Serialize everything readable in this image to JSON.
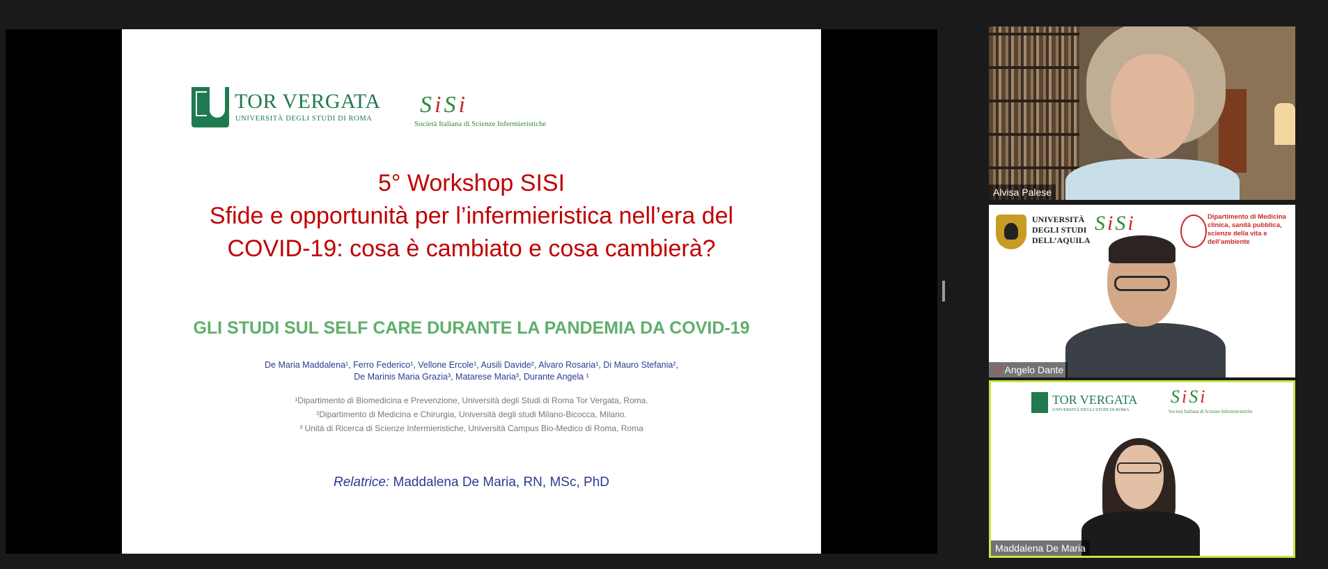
{
  "slide": {
    "logo_tor_vergata": "TOR VERGATA",
    "logo_tor_vergata_sub": "UNIVERSITÀ DEGLI STUDI DI ROMA",
    "logo_sisi": "SiSi",
    "logo_sisi_tag": "Società Italiana di Scienze Infermieristiche",
    "title_line1": "5° Workshop SISI",
    "title_line2": "Sfide e opportunità per l’infermieristica nell’era del",
    "title_line3": "COVID-19: cosa è cambiato e cosa cambierà?",
    "subtitle": "GLI STUDI SUL SELF CARE DURANTE LA PANDEMIA DA COVID-19",
    "authors_line1": "De Maria Maddalena¹, Ferro Federico¹, Vellone Ercole¹, Ausili Davide², Alvaro Rosaria¹, Di Mauro Stefania²,",
    "authors_line2": "De Marinis Maria Grazia³, Matarese Maria³, Durante Angela ¹",
    "affil1": "¹Dipartimento di Biomedicina e Prevenzione, Università degli Studi di Roma Tor Vergata, Roma.",
    "affil2": "²Dipartimento di Medicina e Chirurgia, Università degli studi Milano-Bicocca, Milano.",
    "affil3": "³ Unità di Ricerca di Scienze Infermieristiche, Università Campus Bio-Medico di Roma, Roma",
    "speaker_role": "Relatrice:",
    "speaker_name": " Maddalena De Maria, RN, MSc, PhD"
  },
  "participants": [
    {
      "name": "Alvisa Palese",
      "muted": false
    },
    {
      "name": "Angelo Dante",
      "muted": true,
      "bg_uni": "UNIVERSITÀ\nDEGLI STUDI\nDELL’AQUILA",
      "bg_dip": "Dipartimento di Medicina clinica, sanità pubblica, scienze della vita e dell’ambiente"
    },
    {
      "name": "Maddalena De Maria",
      "muted": false,
      "active_speaker": true
    }
  ],
  "colors": {
    "title_red": "#c00000",
    "subtitle_green": "#5fae6b",
    "authors_blue": "#2f3b8f",
    "active_border": "#c8e64b"
  },
  "icons": {
    "muted": "mic-off-icon"
  }
}
